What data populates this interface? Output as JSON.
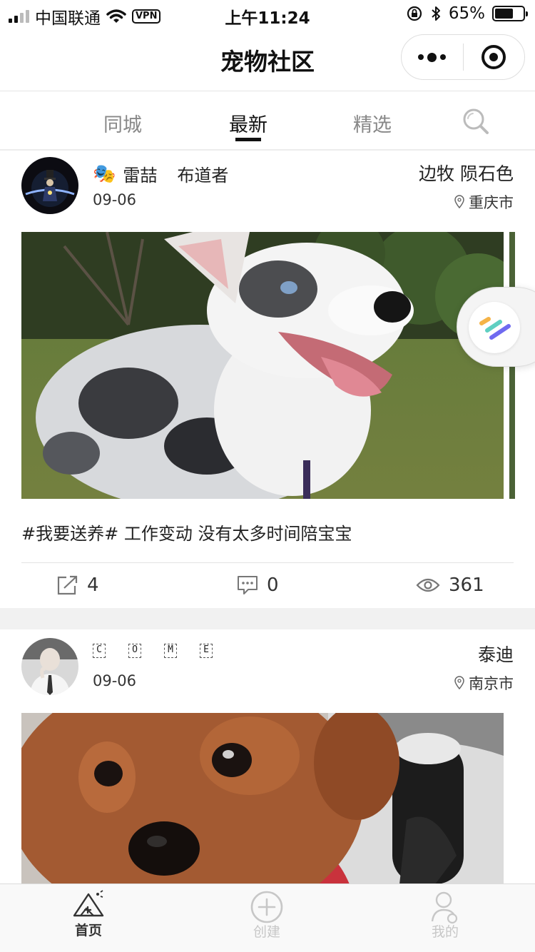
{
  "status_bar": {
    "carrier": "中国联通",
    "vpn": "VPN",
    "time": "上午11:24",
    "battery_percent": "65%",
    "battery_level": 0.65
  },
  "nav": {
    "title": "宠物社区"
  },
  "tabs": [
    {
      "label": "同城",
      "active": false
    },
    {
      "label": "最新",
      "active": true
    },
    {
      "label": "精选",
      "active": false
    }
  ],
  "posts": [
    {
      "user_emoji": "🎭",
      "username": "雷喆",
      "user_title": "布道者",
      "date": "09-06",
      "breed": "边牧 陨石色",
      "city": "重庆市",
      "text": "#我要送养# 工作变动 没有太多时间陪宝宝",
      "shares": "4",
      "comments": "0",
      "views": "361"
    },
    {
      "username_letters": [
        "C",
        "O",
        "M",
        "E"
      ],
      "date": "09-06",
      "breed": "泰迪",
      "city": "南京市"
    }
  ],
  "tabbar": {
    "items": [
      {
        "label": "首页",
        "active": true
      },
      {
        "label": "创建",
        "active": false
      },
      {
        "label": "我的",
        "active": false
      }
    ]
  },
  "colors": {
    "active_text": "#111111",
    "inactive_text": "#888888",
    "tabbar_inactive": "#c7c7c7",
    "separator_band": "#f1f1f1"
  }
}
